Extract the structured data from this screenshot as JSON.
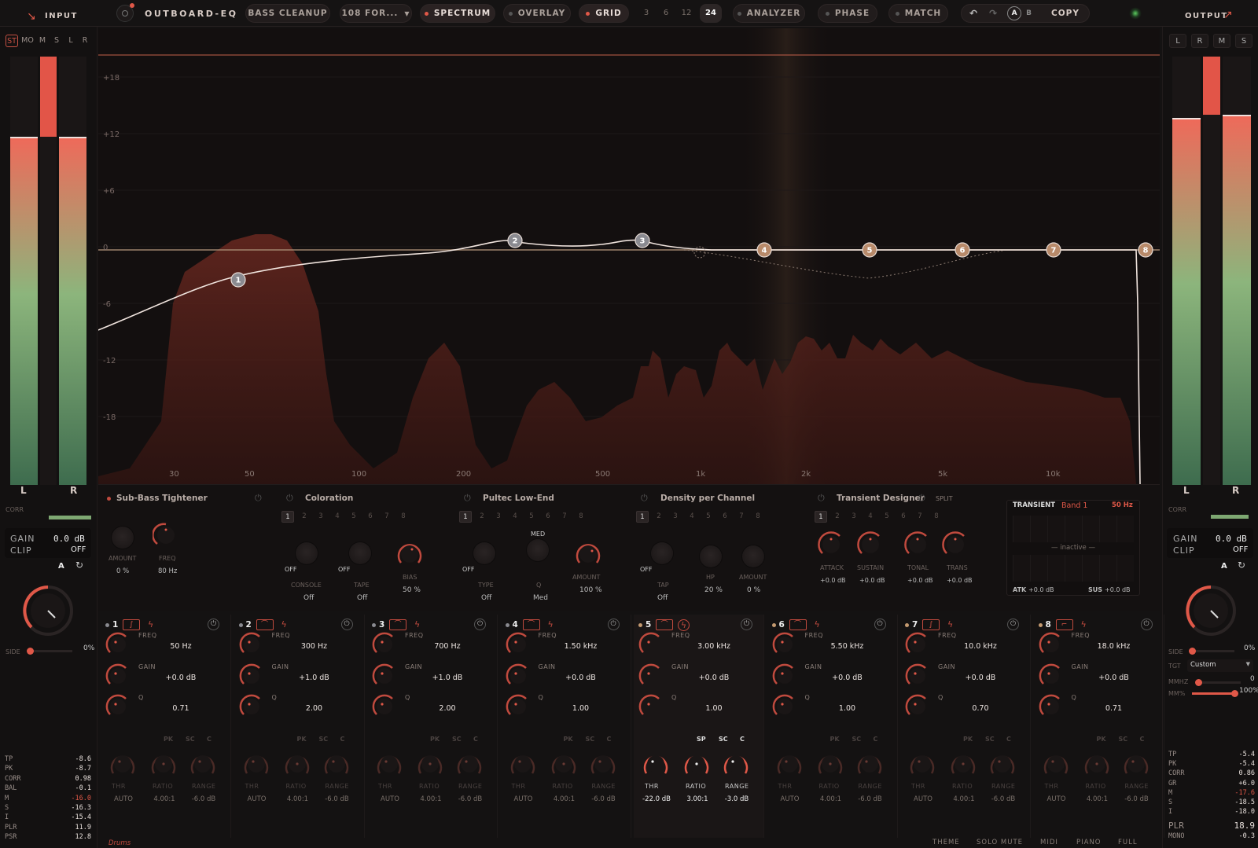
{
  "header": {
    "input_label": "INPUT",
    "plugin_name": "OUTBOARD-EQ",
    "preset": "BASS CLEANUP",
    "preset_select": "108 FOR...",
    "spectrum": "SPECTRUM",
    "overlay": "OVERLAY",
    "grid": "GRID",
    "grid_options": [
      "3",
      "6",
      "12",
      "24"
    ],
    "grid_selected": "24",
    "analyzer": "ANALYZER",
    "phase": "PHASE",
    "match": "MATCH",
    "ab_a": "A",
    "ab_b": "B",
    "copy": "COPY",
    "output_label": "OUTPUT"
  },
  "input": {
    "modes": [
      "ST",
      "MO",
      "M",
      "S",
      "L",
      "R"
    ],
    "meter_l": "L",
    "meter_r": "R",
    "corr": "CORR",
    "gain_label": "GAIN",
    "gain_value": "0.0 dB",
    "clip_label": "CLIP",
    "clip_value": "OFF",
    "a_label": "A",
    "side_label": "SIDE",
    "side_value": "0%",
    "stats": [
      [
        "TP",
        "-8.6"
      ],
      [
        "PK",
        "-8.7"
      ],
      [
        "CORR",
        "0.98"
      ],
      [
        "BAL",
        "-0.1"
      ],
      [
        "M",
        "-16.0"
      ],
      [
        "S",
        "-16.3"
      ],
      [
        "I",
        "-15.4"
      ],
      [
        "PLR",
        "11.9"
      ],
      [
        "PSR",
        "12.8"
      ]
    ]
  },
  "output": {
    "modes": [
      "L",
      "R",
      "M",
      "S"
    ],
    "meter_l": "L",
    "meter_r": "R",
    "corr": "CORR",
    "gain_label": "GAIN",
    "gain_value": "0.0 dB",
    "clip_label": "CLIP",
    "clip_value": "OFF",
    "a_label": "A",
    "side_label": "SIDE",
    "side_value": "0%",
    "tgt_label": "TGT",
    "tgt_value": "Custom",
    "mmhz_label": "MMHZ",
    "mmhz_value": "0",
    "mm_label": "MM%",
    "mm_value": "100%",
    "stats": [
      [
        "TP",
        "-5.4"
      ],
      [
        "PK",
        "-5.4"
      ],
      [
        "CORR",
        "0.86"
      ],
      [
        "GR",
        "+6.0"
      ],
      [
        "M",
        "-17.6"
      ],
      [
        "S",
        "-18.5"
      ],
      [
        "I",
        "-18.0"
      ],
      [
        "PLR",
        "18.9"
      ],
      [
        "MONO",
        "-0.3"
      ]
    ]
  },
  "graph": {
    "db_labels": [
      "+18",
      "+12",
      "+6",
      "0",
      "-6",
      "-12",
      "-18"
    ],
    "freq_labels": [
      "30",
      "50",
      "100",
      "200",
      "500",
      "1k",
      "2k",
      "5k",
      "10k"
    ],
    "nodes": [
      "1",
      "2",
      "3",
      "4",
      "5",
      "6",
      "7",
      "8"
    ]
  },
  "modules": {
    "sub_bass": {
      "title": "Sub-Bass Tightener",
      "amount_label": "AMOUNT",
      "amount_value": "0 %",
      "freq_label": "FREQ",
      "freq_value": "80 Hz"
    },
    "coloration": {
      "title": "Coloration",
      "bands": [
        "1",
        "2",
        "3",
        "4",
        "5",
        "6",
        "7",
        "8"
      ],
      "off1": "OFF",
      "off2": "OFF",
      "console_label": "CONSOLE",
      "console_value": "Off",
      "tape_label": "TAPE",
      "tape_value": "Off",
      "bias_label": "BIAS",
      "bias_value": "50 %"
    },
    "pultec": {
      "title": "Pultec Low-End",
      "bands": [
        "1",
        "2",
        "3",
        "4",
        "5",
        "6",
        "7",
        "8"
      ],
      "off": "OFF",
      "med": "MED",
      "type_label": "TYPE",
      "type_value": "Off",
      "q_label": "Q",
      "q_value": "Med",
      "amount_label": "AMOUNT",
      "amount_value": "100 %"
    },
    "density": {
      "title": "Density per Channel",
      "bands": [
        "1",
        "2",
        "3",
        "4",
        "5",
        "6",
        "7",
        "8"
      ],
      "off": "OFF",
      "tap_label": "TAP",
      "tap_value": "Off",
      "hp_label": "HP",
      "hp_value": "20 %",
      "amount_label": "AMOUNT",
      "amount_value": "0 %"
    },
    "transient": {
      "title": "Transient Designer",
      "split": "SPLIT",
      "bands": [
        "1",
        "2",
        "3",
        "4",
        "5",
        "6",
        "7",
        "8"
      ],
      "attack": "ATTACK",
      "sustain": "SUSTAIN",
      "tonal": "TONAL",
      "trans": "TRANS",
      "attack_v": "+0.0 dB",
      "sustain_v": "+0.0 dB",
      "tonal_v": "+0.0 dB",
      "trans_v": "+0.0 dB"
    },
    "transient_panel": {
      "title": "TRANSIENT",
      "band": "Band 1",
      "freq": "50 Hz",
      "inactive": "— inactive —",
      "atk_label": "ATK",
      "atk_value": "+0.0 dB",
      "sus_label": "SUS",
      "sus_value": "+0.0 dB"
    }
  },
  "bands": [
    {
      "num": "1",
      "freq": "50 Hz",
      "gain": "+0.0 dB",
      "q": "0.71",
      "thr": "AUTO",
      "ratio": "4.00:1",
      "range": "-6.0 dB"
    },
    {
      "num": "2",
      "freq": "300 Hz",
      "gain": "+1.0 dB",
      "q": "2.00",
      "thr": "AUTO",
      "ratio": "4.00:1",
      "range": "-6.0 dB"
    },
    {
      "num": "3",
      "freq": "700 Hz",
      "gain": "+1.0 dB",
      "q": "2.00",
      "thr": "AUTO",
      "ratio": "4.00:1",
      "range": "-6.0 dB"
    },
    {
      "num": "4",
      "freq": "1.50 kHz",
      "gain": "+0.0 dB",
      "q": "1.00",
      "thr": "AUTO",
      "ratio": "4.00:1",
      "range": "-6.0 dB"
    },
    {
      "num": "5",
      "freq": "3.00 kHz",
      "gain": "+0.0 dB",
      "q": "1.00",
      "thr": "-22.0 dB",
      "ratio": "3.00:1",
      "range": "-3.0 dB"
    },
    {
      "num": "6",
      "freq": "5.50 kHz",
      "gain": "+0.0 dB",
      "q": "1.00",
      "thr": "AUTO",
      "ratio": "4.00:1",
      "range": "-6.0 dB"
    },
    {
      "num": "7",
      "freq": "10.0 kHz",
      "gain": "+0.0 dB",
      "q": "0.70",
      "thr": "AUTO",
      "ratio": "4.00:1",
      "range": "-6.0 dB"
    },
    {
      "num": "8",
      "freq": "18.0 kHz",
      "gain": "+0.0 dB",
      "q": "0.71",
      "thr": "AUTO",
      "ratio": "4.00:1",
      "range": "-6.0 dB"
    }
  ],
  "band_labels": {
    "freq": "FREQ",
    "gain": "GAIN",
    "q": "Q",
    "pk": "PK",
    "sc": "SC",
    "c": "C",
    "sp": "SP",
    "thr": "THR",
    "ratio": "RATIO",
    "range": "RANGE"
  },
  "footer": {
    "preset_tag": "Drums",
    "items": [
      "THEME",
      "SOLO MUTE",
      "MIDI",
      "PIANO",
      "FULL"
    ]
  },
  "colors": {
    "accent": "#e05848",
    "background": "#141212",
    "node_warm": "#b88a6a",
    "node_cool": "#8a8a90"
  }
}
